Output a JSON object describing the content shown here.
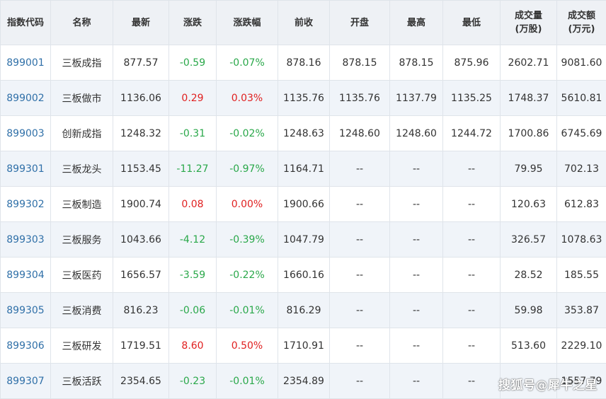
{
  "table": {
    "columns": [
      {
        "key": "code",
        "label": "指数代码"
      },
      {
        "key": "name",
        "label": "名称"
      },
      {
        "key": "latest",
        "label": "最新"
      },
      {
        "key": "change",
        "label": "涨跌"
      },
      {
        "key": "pct",
        "label": "涨跌幅"
      },
      {
        "key": "prev_close",
        "label": "前收"
      },
      {
        "key": "open",
        "label": "开盘"
      },
      {
        "key": "high",
        "label": "最高"
      },
      {
        "key": "low",
        "label": "最低"
      },
      {
        "key": "volume",
        "label": "成交量",
        "sub": "(万股)"
      },
      {
        "key": "amount",
        "label": "成交额",
        "sub": "(万元)"
      }
    ],
    "rows": [
      {
        "code": "899001",
        "name": "三板成指",
        "latest": "877.57",
        "change": "-0.59",
        "pct": "-0.07%",
        "dir": "down",
        "prev_close": "878.16",
        "open": "878.15",
        "high": "878.15",
        "low": "875.96",
        "volume": "2602.71",
        "amount": "9081.60"
      },
      {
        "code": "899002",
        "name": "三板做市",
        "latest": "1136.06",
        "change": "0.29",
        "pct": "0.03%",
        "dir": "up",
        "prev_close": "1135.76",
        "open": "1135.76",
        "high": "1137.79",
        "low": "1135.25",
        "volume": "1748.37",
        "amount": "5610.81"
      },
      {
        "code": "899003",
        "name": "创新成指",
        "latest": "1248.32",
        "change": "-0.31",
        "pct": "-0.02%",
        "dir": "down",
        "prev_close": "1248.63",
        "open": "1248.60",
        "high": "1248.60",
        "low": "1244.72",
        "volume": "1700.86",
        "amount": "6745.69"
      },
      {
        "code": "899301",
        "name": "三板龙头",
        "latest": "1153.45",
        "change": "-11.27",
        "pct": "-0.97%",
        "dir": "down",
        "prev_close": "1164.71",
        "open": "--",
        "high": "--",
        "low": "--",
        "volume": "79.95",
        "amount": "702.13"
      },
      {
        "code": "899302",
        "name": "三板制造",
        "latest": "1900.74",
        "change": "0.08",
        "pct": "0.00%",
        "dir": "up",
        "prev_close": "1900.66",
        "open": "--",
        "high": "--",
        "low": "--",
        "volume": "120.63",
        "amount": "612.83"
      },
      {
        "code": "899303",
        "name": "三板服务",
        "latest": "1043.66",
        "change": "-4.12",
        "pct": "-0.39%",
        "dir": "down",
        "prev_close": "1047.79",
        "open": "--",
        "high": "--",
        "low": "--",
        "volume": "326.57",
        "amount": "1078.63"
      },
      {
        "code": "899304",
        "name": "三板医药",
        "latest": "1656.57",
        "change": "-3.59",
        "pct": "-0.22%",
        "dir": "down",
        "prev_close": "1660.16",
        "open": "--",
        "high": "--",
        "low": "--",
        "volume": "28.52",
        "amount": "185.55"
      },
      {
        "code": "899305",
        "name": "三板消费",
        "latest": "816.23",
        "change": "-0.06",
        "pct": "-0.01%",
        "dir": "down",
        "prev_close": "816.29",
        "open": "--",
        "high": "--",
        "low": "--",
        "volume": "59.98",
        "amount": "353.87"
      },
      {
        "code": "899306",
        "name": "三板研发",
        "latest": "1719.51",
        "change": "8.60",
        "pct": "0.50%",
        "dir": "up",
        "prev_close": "1710.91",
        "open": "--",
        "high": "--",
        "low": "--",
        "volume": "513.60",
        "amount": "2229.10"
      },
      {
        "code": "899307",
        "name": "三板活跃",
        "latest": "2354.65",
        "change": "-0.23",
        "pct": "-0.01%",
        "dir": "down",
        "prev_close": "2354.89",
        "open": "--",
        "high": "--",
        "low": "--",
        "volume": "",
        "amount": "1557.79"
      }
    ]
  },
  "colors": {
    "up": "#e02020",
    "down": "#2aa84a",
    "code_link": "#3070a8",
    "header_bg": "#eef1f5",
    "stripe_bg": "#f0f4f9",
    "border": "#dfe4ea"
  },
  "watermark": "搜狐号@犀牛之星"
}
